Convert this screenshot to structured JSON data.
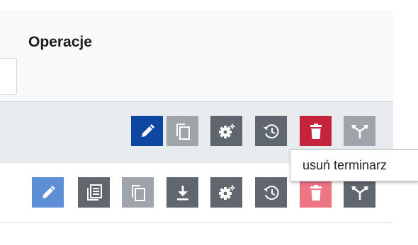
{
  "header": {
    "title": "Operacje"
  },
  "rows": [
    {
      "actions": [
        {
          "name": "edit",
          "icon": "pencil-icon",
          "color": "#0d47a1"
        },
        {
          "name": "copy",
          "icon": "copy-icon",
          "color": "#9ea4aa"
        },
        {
          "name": "settings",
          "icon": "gear-icon",
          "color": "#5f666d"
        },
        {
          "name": "history",
          "icon": "history-icon",
          "color": "#5f666d"
        },
        {
          "name": "delete",
          "icon": "trash-icon",
          "color": "#c5253a"
        },
        {
          "name": "merge",
          "icon": "merge-icon",
          "color": "#9ea4aa"
        }
      ]
    },
    {
      "actions": [
        {
          "name": "edit",
          "icon": "pencil-icon",
          "color": "#5e8ed5"
        },
        {
          "name": "list",
          "icon": "list-icon",
          "color": "#5f666d"
        },
        {
          "name": "copy",
          "icon": "copy-icon",
          "color": "#9ea4aa"
        },
        {
          "name": "download",
          "icon": "download-icon",
          "color": "#5f666d"
        },
        {
          "name": "settings",
          "icon": "gear-icon",
          "color": "#5f666d"
        },
        {
          "name": "history",
          "icon": "history-icon",
          "color": "#5f666d"
        },
        {
          "name": "delete",
          "icon": "trash-icon",
          "color": "#ec7483"
        },
        {
          "name": "merge",
          "icon": "merge-icon",
          "color": "#5f666d"
        }
      ]
    }
  ],
  "tooltip": {
    "text": "usuń terminarz"
  }
}
